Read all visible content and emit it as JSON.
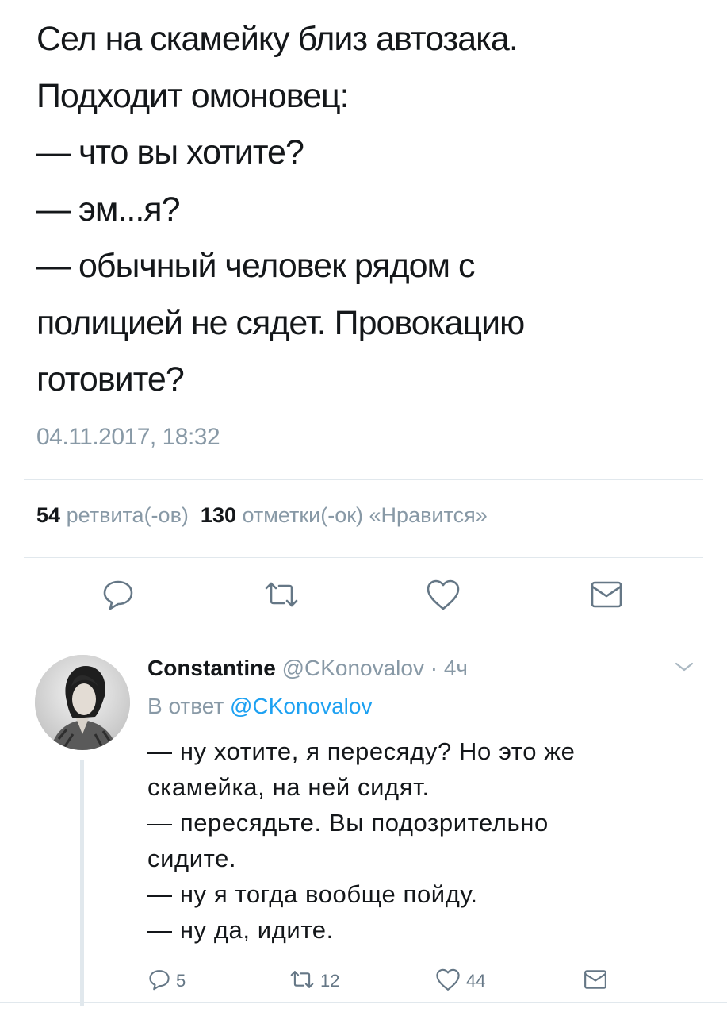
{
  "main_tweet": {
    "lines": [
      "Сел на скамейку близ автозака.",
      "Подходит омоновец:",
      "— что вы хотите?",
      "— эм...я?",
      "— обычный человек рядом с",
      "полицией не сядет. Провокацию",
      "готовите?"
    ],
    "timestamp": "04.11.2017, 18:32"
  },
  "stats": {
    "retweets_count": "54",
    "retweets_label": "ретвита(-ов)",
    "likes_count": "130",
    "likes_label": "отметки(-ок) «Нравится»"
  },
  "actions": {
    "icons": [
      "reply-icon",
      "retweet-icon",
      "like-icon",
      "message-icon"
    ]
  },
  "reply": {
    "name": "Constantine",
    "handle": "@CKonovalov",
    "separator": "·",
    "time": "4ч",
    "in_reply_prefix": "В ответ",
    "in_reply_mention": "@CKonovalov",
    "lines": [
      "— ну хотите, я пересяду? Но это же",
      "скамейка, на ней сидят.",
      "— пересядьте. Вы подозрительно",
      "сидите.",
      "— ну я тогда вообще пойду.",
      "— ну да, идите."
    ],
    "reply_count": "5",
    "retweet_count": "12",
    "like_count": "44"
  },
  "colors": {
    "text": "#14171a",
    "muted": "#8899a6",
    "link": "#1da1f2",
    "icon": "#657786",
    "divider": "#e1e8ed"
  }
}
